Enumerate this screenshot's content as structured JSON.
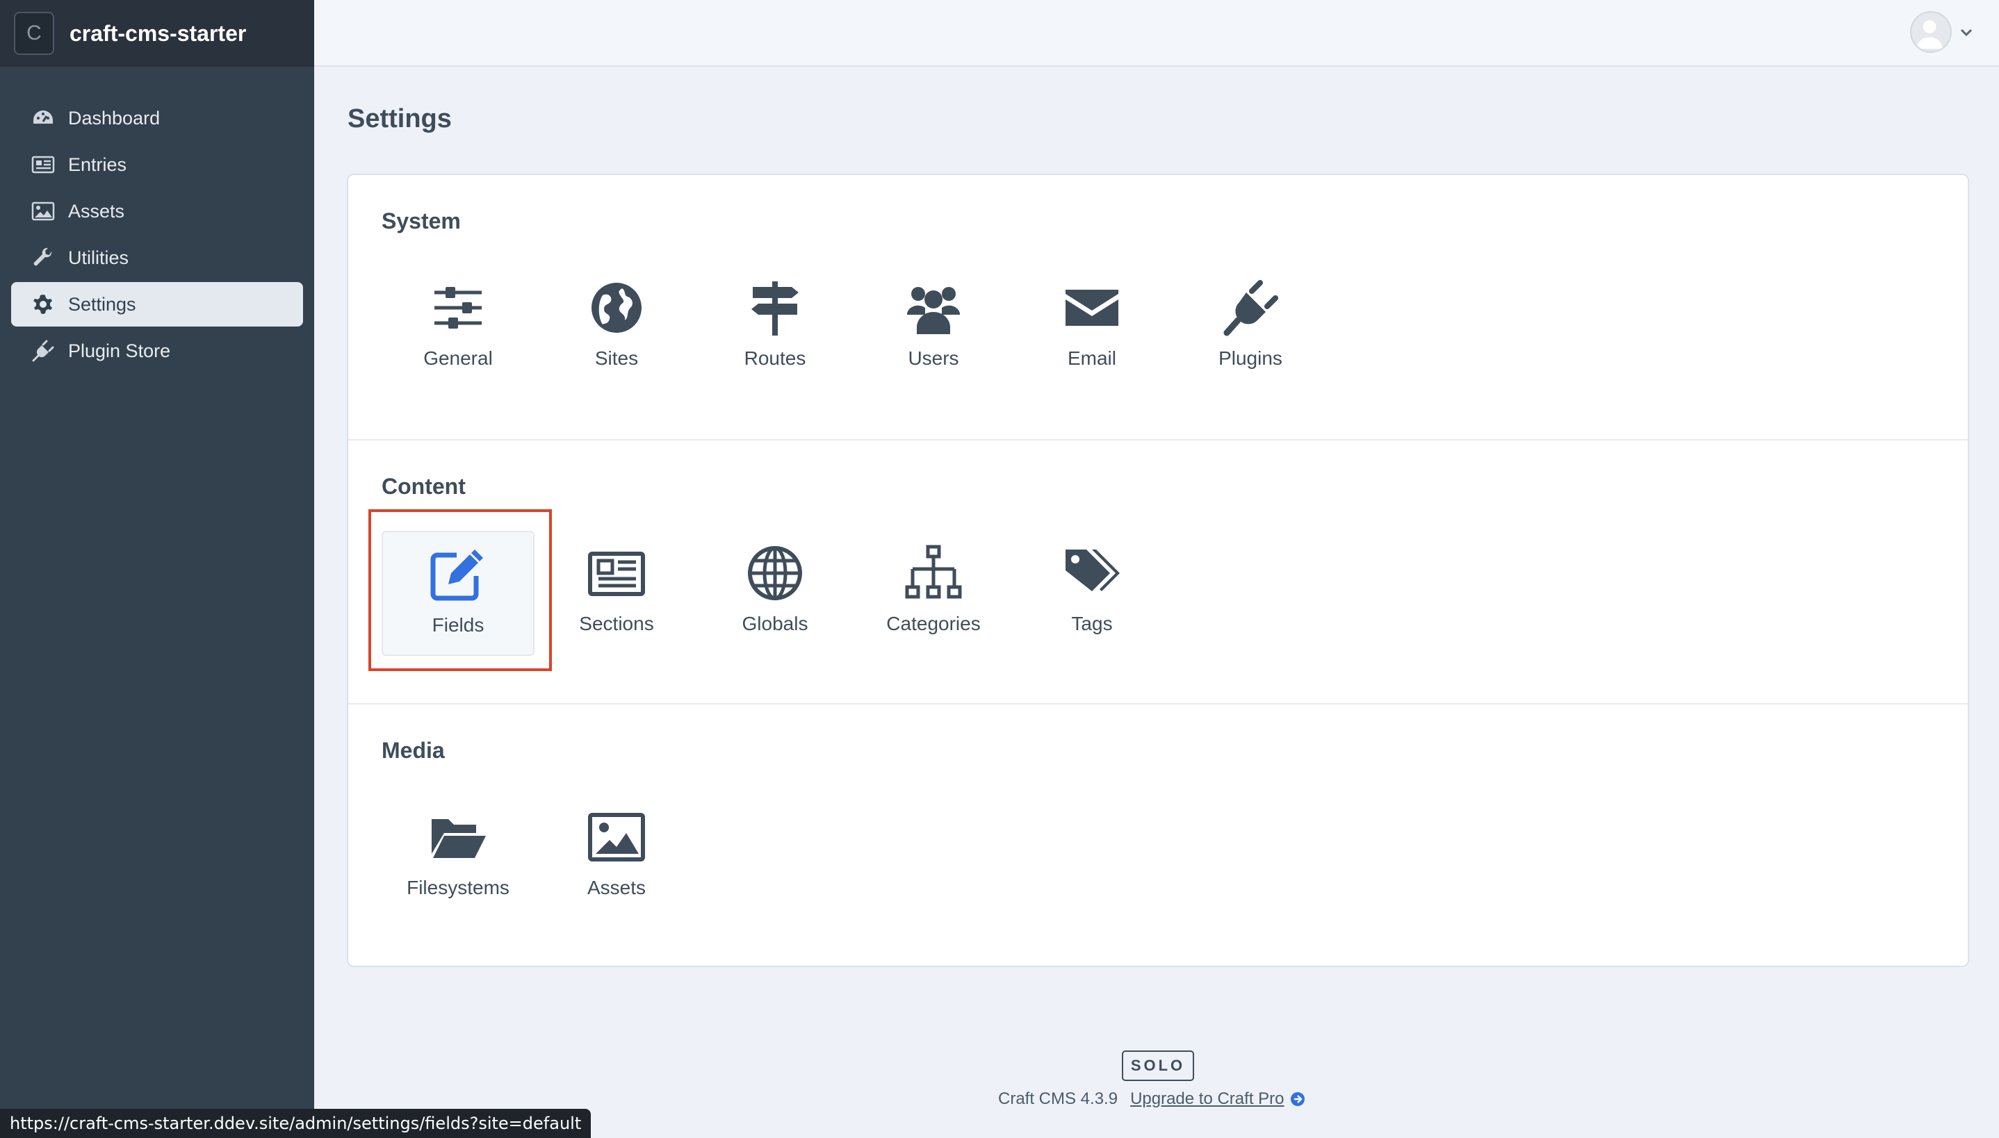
{
  "site": {
    "icon_letter": "C",
    "name": "craft-cms-starter"
  },
  "nav": [
    {
      "label": "Dashboard",
      "icon": "dashboard-icon",
      "active": false
    },
    {
      "label": "Entries",
      "icon": "newspaper-icon",
      "active": false
    },
    {
      "label": "Assets",
      "icon": "image-icon",
      "active": false
    },
    {
      "label": "Utilities",
      "icon": "wrench-icon",
      "active": false
    },
    {
      "label": "Settings",
      "icon": "gear-icon",
      "active": true
    },
    {
      "label": "Plugin Store",
      "icon": "plug-icon",
      "active": false
    }
  ],
  "page": {
    "title": "Settings"
  },
  "sections": {
    "system": {
      "title": "System",
      "items": [
        {
          "label": "General",
          "icon": "sliders-icon"
        },
        {
          "label": "Sites",
          "icon": "globe-americas-icon"
        },
        {
          "label": "Routes",
          "icon": "signpost-icon"
        },
        {
          "label": "Users",
          "icon": "users-icon"
        },
        {
          "label": "Email",
          "icon": "envelope-icon"
        },
        {
          "label": "Plugins",
          "icon": "plug-icon"
        }
      ]
    },
    "content": {
      "title": "Content",
      "items": [
        {
          "label": "Fields",
          "icon": "pencil-square-icon"
        },
        {
          "label": "Sections",
          "icon": "newspaper-icon"
        },
        {
          "label": "Globals",
          "icon": "globe-icon"
        },
        {
          "label": "Categories",
          "icon": "sitemap-icon"
        },
        {
          "label": "Tags",
          "icon": "tags-icon"
        }
      ]
    },
    "media": {
      "title": "Media",
      "items": [
        {
          "label": "Filesystems",
          "icon": "folder-open-icon"
        },
        {
          "label": "Assets",
          "icon": "image-icon"
        }
      ]
    }
  },
  "footer": {
    "edition": "SOLO",
    "version": "Craft CMS 4.3.9",
    "upgrade_label": "Upgrade to Craft Pro"
  },
  "status_url": "https://craft-cms-starter.ddev.site/admin/settings/fields?site=default",
  "colors": {
    "sidebar": "#33404d",
    "sidebar_header": "#29323d",
    "icon_gray": "#3f4d5a",
    "accent_blue": "#3370e0",
    "highlight": "#d9452a"
  }
}
